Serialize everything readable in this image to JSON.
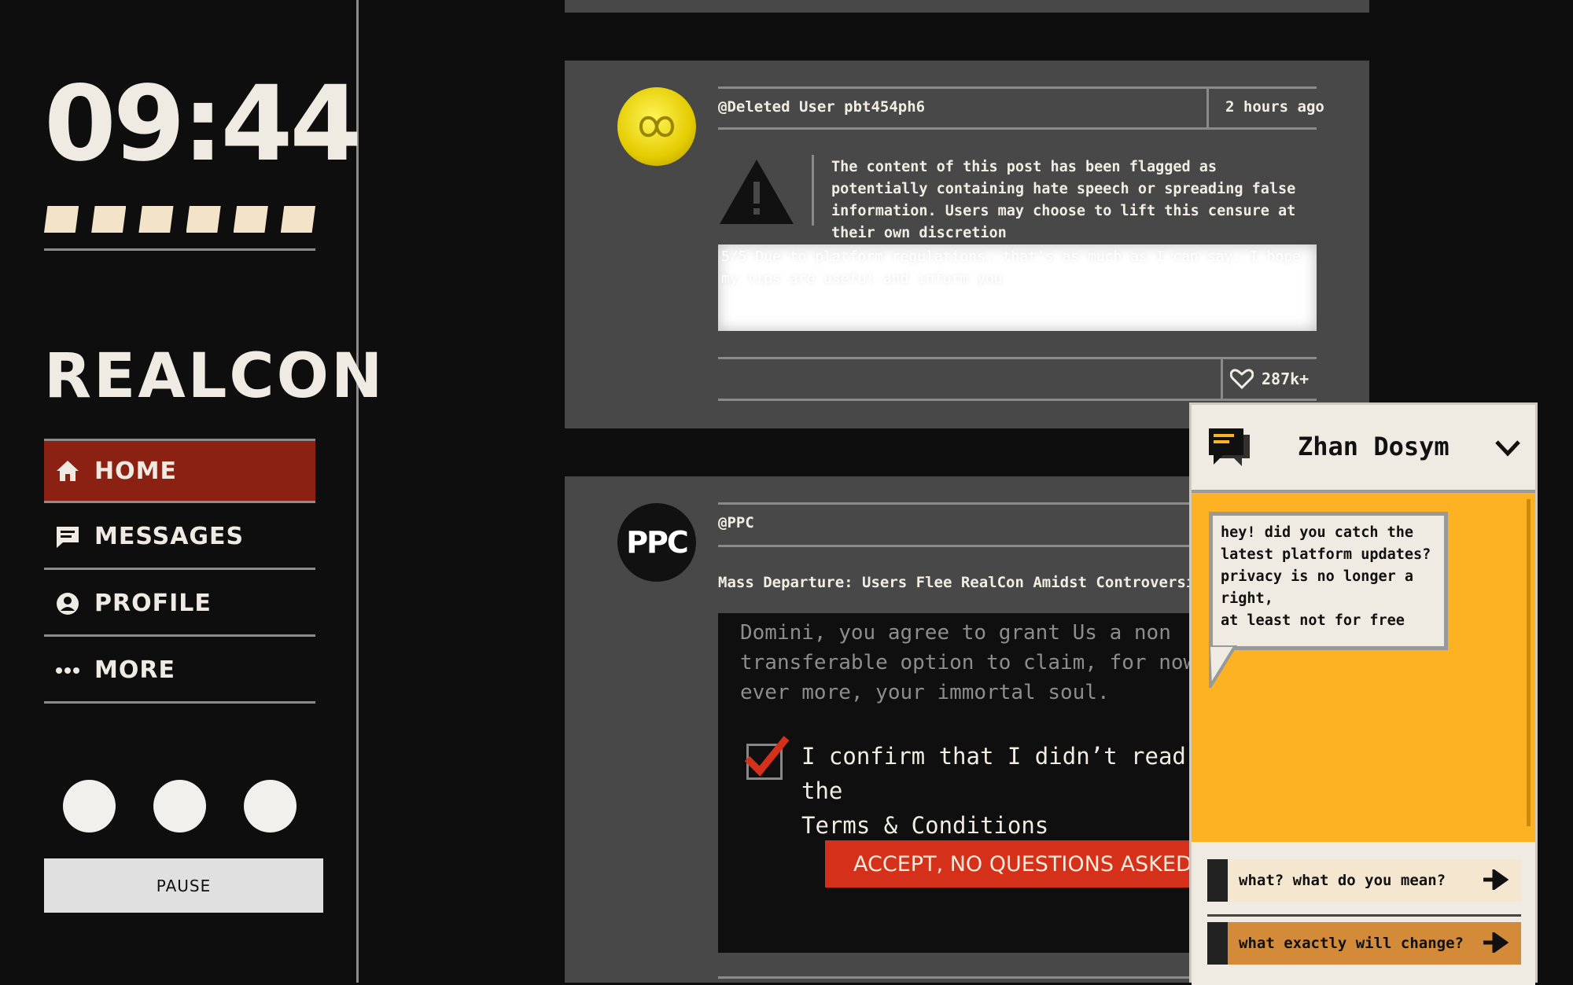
{
  "sidebar": {
    "clock": "09:44",
    "battery_segments": 6,
    "logo": "REALCON",
    "nav": [
      {
        "label": "HOME",
        "icon": "home-icon",
        "active": true
      },
      {
        "label": "MESSAGES",
        "icon": "message-icon",
        "active": false
      },
      {
        "label": "PROFILE",
        "icon": "profile-icon",
        "active": false
      },
      {
        "label": "MORE",
        "icon": "more-icon",
        "active": false
      }
    ],
    "pause_label": "PAUSE"
  },
  "post1": {
    "author": "@Deleted User pbt454ph6",
    "time": "2 hours ago",
    "warning": "The content of this post has been flagged as potentially containing hate speech or spreading false information. Users may choose to lift this censure at their own discretion",
    "blurred_text": "5/5 Due to platform regulations, that's as much as I can say. I hope my tips are useful and inform you",
    "likes": "287k+"
  },
  "post2": {
    "author": "@PPC",
    "avatar_text": "PPC",
    "headline": "Mass Departure: Users Flee RealCon Amidst Controversial Po",
    "terms_line1": "Domini, you agree to grant Us a non",
    "terms_line2": "transferable option to claim, for now",
    "terms_line3": "ever more, your immortal soul.",
    "confirm_line1": "I confirm that I didn’t read the",
    "confirm_line2": "Terms & Conditions",
    "accept_label": "ACCEPT, NO QUESTIONS ASKED"
  },
  "chat": {
    "contact": "Zhan Dosym",
    "message_line1": "hey! did you catch the",
    "message_line2": "latest platform updates?",
    "message_line3": "privacy is no longer a right,",
    "message_line4": "at least not for free",
    "replies": [
      {
        "label": "what? what do you mean?"
      },
      {
        "label": "what exactly will change?"
      }
    ]
  },
  "colors": {
    "accent_red": "#8b2113",
    "button_red": "#d4301a",
    "chat_orange": "#fdb223"
  }
}
